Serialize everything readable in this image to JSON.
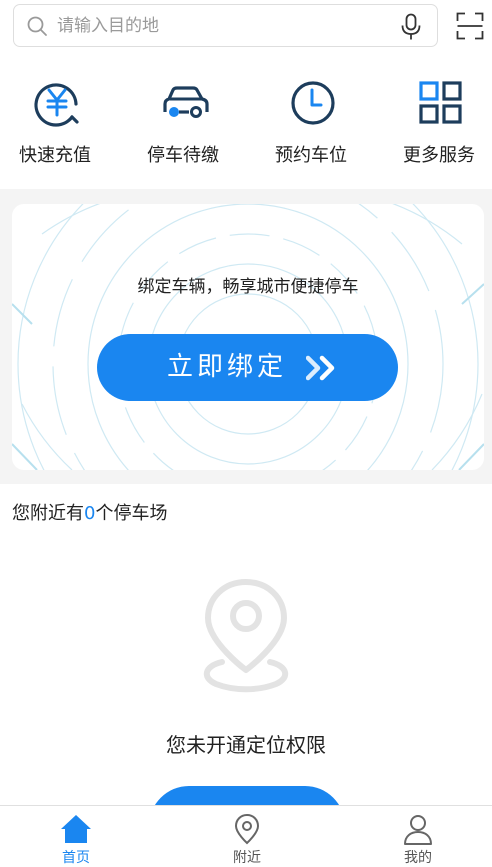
{
  "search": {
    "placeholder": "请输入目的地"
  },
  "quick_actions": [
    {
      "label": "快速充值",
      "icon": "yen-recharge-icon"
    },
    {
      "label": "停车待缴",
      "icon": "car-icon"
    },
    {
      "label": "预约车位",
      "icon": "clock-icon"
    },
    {
      "label": "更多服务",
      "icon": "grid-icon"
    }
  ],
  "bind_card": {
    "tagline": "绑定车辆，畅享城市便捷停车",
    "button_label": "立即绑定"
  },
  "nearby": {
    "prefix": "您附近有",
    "count": "0",
    "suffix": "个停车场",
    "permission_text": "您未开通定位权限"
  },
  "tabbar": [
    {
      "label": "首页",
      "icon": "home-icon",
      "active": true
    },
    {
      "label": "附近",
      "icon": "location-pin-icon",
      "active": false
    },
    {
      "label": "我的",
      "icon": "user-icon",
      "active": false
    }
  ],
  "colors": {
    "accent": "#1a86f0",
    "icon_dark": "#1d3d5c",
    "gray_bg": "#f4f4f4"
  }
}
